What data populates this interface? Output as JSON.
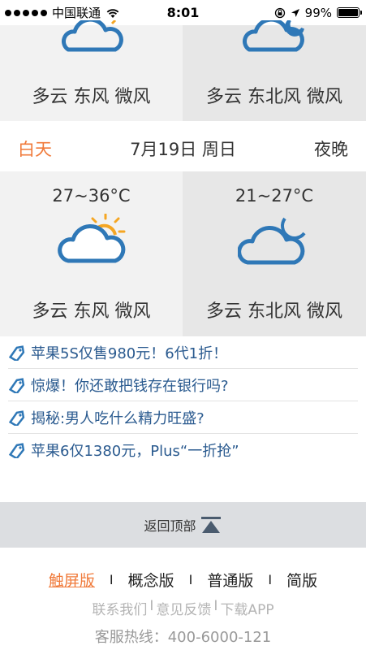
{
  "status_bar": {
    "carrier": "中国联通",
    "time": "8:01",
    "battery": "99%",
    "battery_level": 0.99,
    "signal_bars_filled": 5
  },
  "top_row": {
    "left_text": "多云 东风 微风",
    "right_text": "多云 东北风 微风"
  },
  "date_bar": {
    "day_label": "白天",
    "date": "7月19日 周日",
    "night_label": "夜晚"
  },
  "bottom_row": {
    "day_temp": "27~36°C",
    "day_text": "多云 东风 微风",
    "night_temp": "21~27°C",
    "night_text": "多云 东北风 微风"
  },
  "news": [
    {
      "text": "苹果5S仅售980元！6代1折！",
      "icon": "tag-icon"
    },
    {
      "text": "惊爆！你还敢把钱存在银行吗?",
      "icon": "tag-icon"
    },
    {
      "text": "揭秘:男人吃什么精力旺盛?",
      "icon": "tag-icon"
    },
    {
      "text": "苹果6仅1380元，Plus“一折抢”",
      "icon": "tag-icon"
    }
  ],
  "back_to_top": {
    "label": "返回顶部",
    "icon": "up-arrow-icon"
  },
  "footer": {
    "versions": [
      "触屏版",
      "概念版",
      "普通版",
      "简版"
    ],
    "version_separator": "I",
    "links": [
      "联系我们",
      "意见反馈",
      "下载APP"
    ],
    "link_separator": "I",
    "hotline": "客服热线：400-6000-121"
  },
  "colors": {
    "accent": "#f07a3a",
    "icon_blue": "#2f78b7",
    "sun_orange": "#f5a623",
    "link_blue": "#2a5a8f"
  }
}
